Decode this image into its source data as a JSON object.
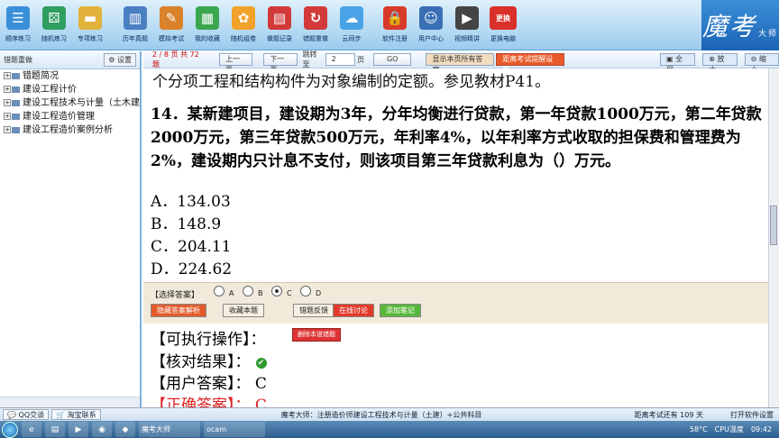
{
  "toolbar": {
    "items": [
      {
        "label": "顺序练习",
        "icon": "list-icon",
        "color": "#3a8fd9"
      },
      {
        "label": "随机练习",
        "icon": "dice-icon",
        "color": "#2f9e5f"
      },
      {
        "label": "专项练习",
        "icon": "folder-icon",
        "color": "#e2b23a"
      },
      {
        "label": "历年真题",
        "icon": "books-icon",
        "color": "#4a7fc1"
      },
      {
        "label": "模拟考试",
        "icon": "pencil-icon",
        "color": "#d9822b"
      },
      {
        "label": "我的收藏",
        "icon": "grid-icon",
        "color": "#3aa650"
      },
      {
        "label": "随机组卷",
        "icon": "flower-icon",
        "color": "#f2a22a"
      },
      {
        "label": "做题记录",
        "icon": "calendar-icon",
        "color": "#d23a3a"
      },
      {
        "label": "错题重做",
        "icon": "calendar-redo-icon",
        "color": "#d23a3a"
      },
      {
        "label": "云同步",
        "icon": "cloud-icon",
        "color": "#4aa3e6"
      },
      {
        "label": "软件注册",
        "icon": "lock-icon",
        "color": "#d83a2a"
      },
      {
        "label": "用户中心",
        "icon": "user-icon",
        "color": "#3a6fb5"
      },
      {
        "label": "视频精讲",
        "icon": "film-icon",
        "color": "#444444"
      },
      {
        "label": "更换电脑",
        "icon": "computer-swap-icon",
        "color": "#d9302a"
      }
    ],
    "swap_text": "更换",
    "brand": "魔考",
    "brand_sub": "大师"
  },
  "left": {
    "header": "错题重做",
    "settings": "设置",
    "tree": [
      "错题简况",
      "建设工程计价",
      "建设工程技术与计量（土木建",
      "建设工程造价管理",
      "建设工程造价案例分析"
    ]
  },
  "nav": {
    "page_info": "2 / 8 页  共 72 题",
    "prev": "上一页",
    "next": "下一页",
    "jump_label": "跳转至",
    "jump_value": "2",
    "page_unit": "页",
    "go": "GO",
    "show_all": "显示本页所有答案",
    "exam_reminder": "距离考试提醒设置",
    "fullscreen": "全屏",
    "zoom_in": "放大",
    "zoom_out": "缩小"
  },
  "question": {
    "prev_tail": "个分项工程和结构构件为对象编制的定额。参见教材P41。",
    "text": "14．某新建项目，建设期为3年，分年均衡进行贷款，第一年贷款1000万元，第二年贷款2000万元，第三年贷款500万元，年利率4%，以年利率方式收取的担保费和管理费为2%，建设期内只计息不支付，则该项目第三年贷款利息为（）万元。",
    "options": [
      "A．134.03",
      "B．148.9",
      "C．204.11",
      "D．224.62"
    ]
  },
  "answer": {
    "select_label": "【选择答案】",
    "choices": [
      "A",
      "B",
      "C",
      "D"
    ],
    "selected": "C",
    "buttons": [
      {
        "label": "隐藏答案解析",
        "bg": "#e25a2a",
        "fg": "#ffffff"
      },
      {
        "label": "收藏本题",
        "bg": "#f6efe2",
        "fg": "#222222"
      },
      {
        "label": "错题反馈",
        "bg": "#f6efe2",
        "fg": "#222222"
      },
      {
        "label": "在线讨论",
        "bg": "#e23a2a",
        "fg": "#ffffff"
      },
      {
        "label": "添加笔记",
        "bg": "#58b83a",
        "fg": "#ffffff"
      }
    ]
  },
  "result": {
    "actions_label": "【可执行操作】：",
    "delete_btn": "删除本道错题",
    "check_label": "【核对结果】：",
    "user_label": "【用户答案】：",
    "user_answer": "C",
    "correct_label": "【正确答案】：",
    "correct_answer": "C"
  },
  "statusbar": {
    "qq": "QQ交谈",
    "contact": "淘宝联系",
    "product": "魔考大师：注册造价师建设工程技术与计量（土建）+公共科目",
    "countdown": "距离考试还有 109 天",
    "open_settings": "打开软件设置"
  },
  "taskbar": {
    "app1": "魔考大师",
    "app2": "ocam",
    "temp": "58°C",
    "cpu_label": "CPU温度",
    "time": "09:42"
  }
}
